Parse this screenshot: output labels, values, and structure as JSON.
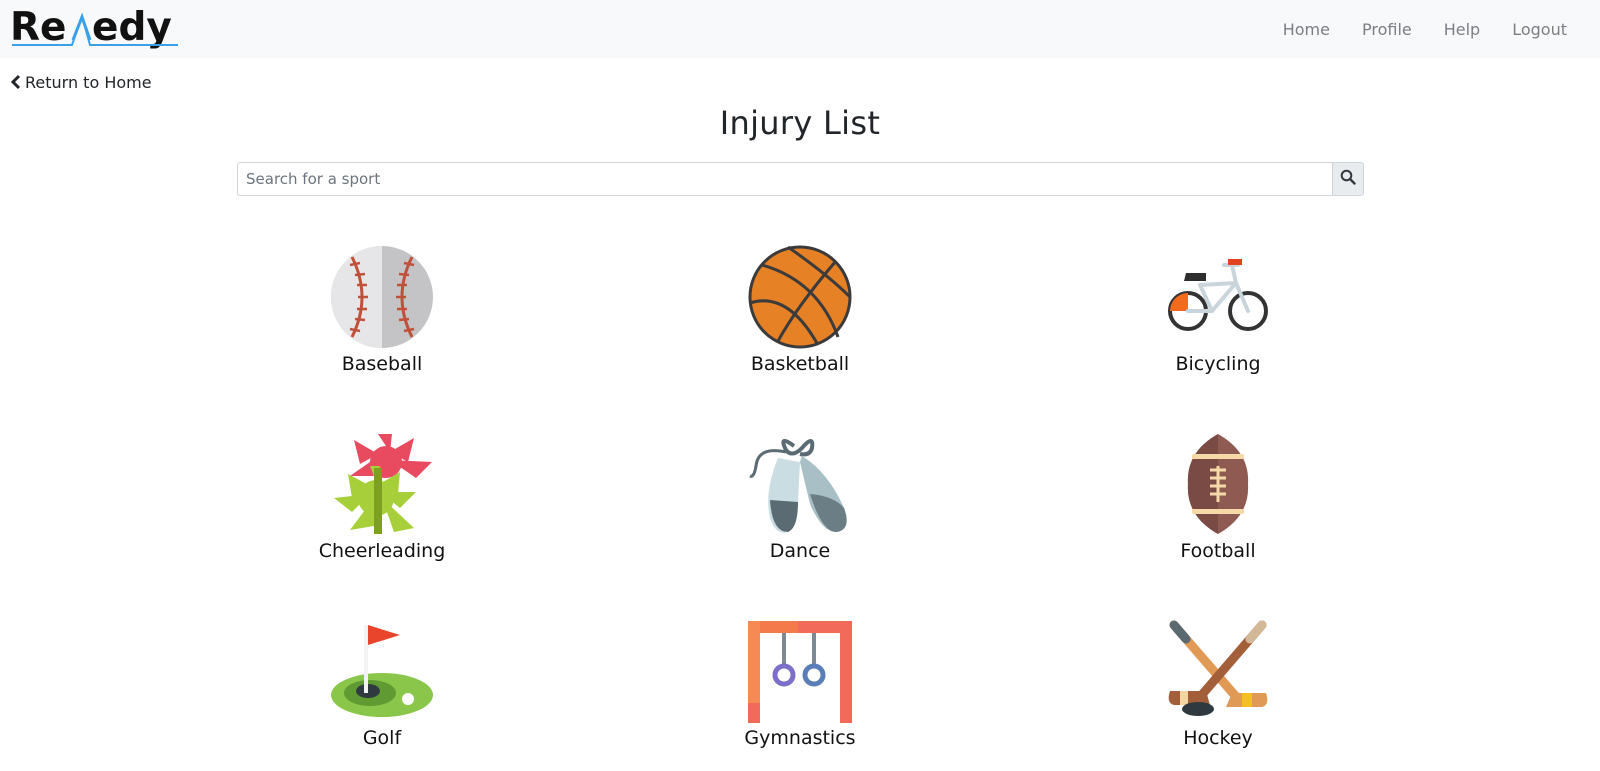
{
  "brand": {
    "name": "ReMedy",
    "part1": "Re",
    "part2": "edy"
  },
  "nav": {
    "items": [
      {
        "label": "Home"
      },
      {
        "label": "Profile"
      },
      {
        "label": "Help"
      },
      {
        "label": "Logout"
      }
    ]
  },
  "back_link": {
    "label": "Return to Home",
    "icon": "chevron-left-icon"
  },
  "page_title": "Injury List",
  "search": {
    "placeholder": "Search for a sport",
    "value": "",
    "icon": "search-icon"
  },
  "sports": [
    {
      "label": "Baseball",
      "icon": "baseball-icon"
    },
    {
      "label": "Basketball",
      "icon": "basketball-icon"
    },
    {
      "label": "Bicycling",
      "icon": "bicycle-icon"
    },
    {
      "label": "Cheerleading",
      "icon": "pompom-icon"
    },
    {
      "label": "Dance",
      "icon": "ballet-shoes-icon"
    },
    {
      "label": "Football",
      "icon": "football-icon"
    },
    {
      "label": "Golf",
      "icon": "golf-flag-icon"
    },
    {
      "label": "Gymnastics",
      "icon": "gymnastic-rings-icon"
    },
    {
      "label": "Hockey",
      "icon": "hockey-sticks-icon"
    }
  ]
}
